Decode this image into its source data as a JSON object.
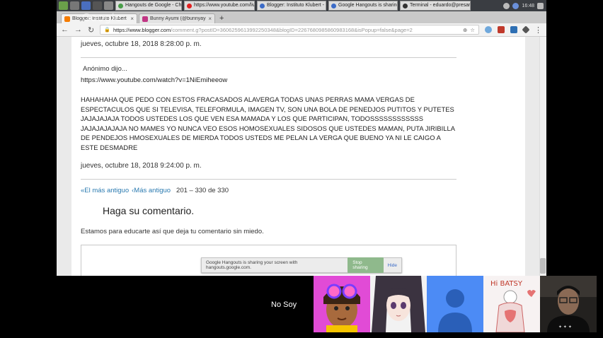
{
  "taskbar": {
    "tasks": [
      {
        "label": "Hangouts de Google - Chro...",
        "color": "#4a9d4a"
      },
      {
        "label": "https://www.youtube.com/liv...",
        "color": "#e02020"
      },
      {
        "label": "Blogger: Instituto Klubert - P...",
        "color": "#3b6bc7"
      },
      {
        "label": "Google Hangouts is sharing...",
        "color": "#3b6bc7"
      },
      {
        "label": "Terminal - eduardo@presari...",
        "color": "#333333"
      }
    ],
    "clock": "16:48"
  },
  "browser": {
    "tabs": [
      {
        "label": "Blogger: Instituto Klubert - Publ",
        "favicon_color": "#f57c00"
      },
      {
        "label": "Bunny Ayumi (@bunnyayumi)",
        "favicon_color": "#c13584"
      }
    ],
    "url_host": "https://www.blogger.com",
    "url_path": "/comment.g?postID=3606259613992250348&blogID=2267680985860983168&isPopup=false&page=2"
  },
  "overlay_logo": "Google",
  "page": {
    "prev_timestamp": "jueves, octubre 18, 2018 8:28:00 p. m.",
    "comment": {
      "author": "Anónimo dijo...",
      "link": "https://www.youtube.com/watch?v=1NiEmiheeow",
      "body": "HAHAHAHA QUE PEDO CON ESTOS FRACASADOS ALAVERGA TODAS UNAS PERRAS MAMA VERGAS DE ESPECTACULOS QUE SI TELEVISA, TELEFORMULA, IMAGEN TV, SON UNA BOLA DE PENEDJOS PUTITOS Y PUTETES JAJAJAJAJA TODOS USTEDES LOS QUE VEN ESA MAMADA Y LOS QUE PARTICIPAN, TODOSSSSSSSSSSSS JAJAJAJAJAJA NO MAMES YO NUNCA VEO ESOS HOMOSEXUALES SIDOSOS QUE USTEDES MAMAN, PUTA JIRIBILLA DE PENDEJOS HMOSEXUALES DE MIERDA TODOS USTEDS ME PELAN LA VERGA QUE BUENO YA NI LE CAIGO A ESTE DESMADRE",
      "timestamp": "jueves, octubre 18, 2018 9:24:00 p. m."
    },
    "pager": {
      "oldest": "«El más antiguo",
      "older": "‹Más antiguo",
      "range": "201 – 330 de 330"
    },
    "form_title": "Haga su comentario.",
    "form_note": "Estamos para educarte así que deja tu comentario sin miedo."
  },
  "share_banner": {
    "text": "Google Hangouts is sharing your screen with hangouts.google.com.",
    "stop_label": "Stop sharing",
    "hide_label": "Hide"
  },
  "hangout": {
    "speaker_name": "No Soy",
    "tiles": [
      {
        "kind": "cartoon-avatar",
        "bg": "#e14bd6"
      },
      {
        "kind": "anime-avatar",
        "bg": "#f2f2f2"
      },
      {
        "kind": "default-avatar",
        "bg": "#4c8bf5"
      },
      {
        "kind": "sketch-avatar",
        "bg": "#f7f2f2"
      },
      {
        "kind": "camera-feed",
        "bg": "#1a1a1a"
      }
    ],
    "sketch_text": "Hi BATSY"
  },
  "colors": {
    "link": "#2a7ab0",
    "accent_green": "#8fb98c"
  }
}
